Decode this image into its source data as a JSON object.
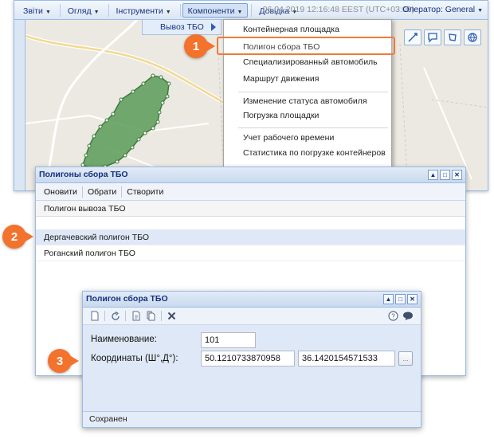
{
  "menubar": {
    "items": [
      {
        "label": "Звіти"
      },
      {
        "label": "Огляд"
      },
      {
        "label": "Інструменти"
      },
      {
        "label": "Компоненти"
      },
      {
        "label": "Довідка"
      }
    ],
    "datetime": "06.04.2019 12:16:48 EEST (UTC+03:00)",
    "operator": "Оператор: General"
  },
  "submenu": {
    "parent_label": "Вывоз ТБО",
    "items": [
      {
        "label": "Контейнерная площадка"
      },
      {
        "label": "Полигон сбора ТБО"
      },
      {
        "label": "Специализированный автомобиль"
      },
      {
        "label": "Маршрут движения"
      },
      {
        "label": "Изменение статуса автомобиля"
      },
      {
        "label": "Погрузка площадки"
      },
      {
        "label": "Учет рабочего времени"
      },
      {
        "label": "Статистика по погрузке контейнеров"
      }
    ]
  },
  "steps": [
    "1",
    "2",
    "3"
  ],
  "list_window": {
    "title": "Полигоны сбора ТБО",
    "toolbar": {
      "refresh": "Оновити",
      "select": "Обрати",
      "create": "Створити"
    },
    "header": "Полигон вывоза ТБО",
    "rows": [
      {
        "name": "Дергачевский полигон ТБО"
      },
      {
        "name": "Роганский полигон ТБО"
      }
    ]
  },
  "form_window": {
    "title": "Полигон сбора ТБО",
    "name_label": "Наименование:",
    "name_value": "101",
    "coords_label": "Координаты (Ш°,Д°):",
    "lat_value": "50.1210733870958",
    "lon_value": "36.1420154571533",
    "pick_label": "...",
    "status": "Сохранен"
  },
  "colors": {
    "accent": "#f3722c",
    "header_blue": "#15317e",
    "border_blue": "#99bbe8",
    "polygon_green": "#5a9b58"
  }
}
